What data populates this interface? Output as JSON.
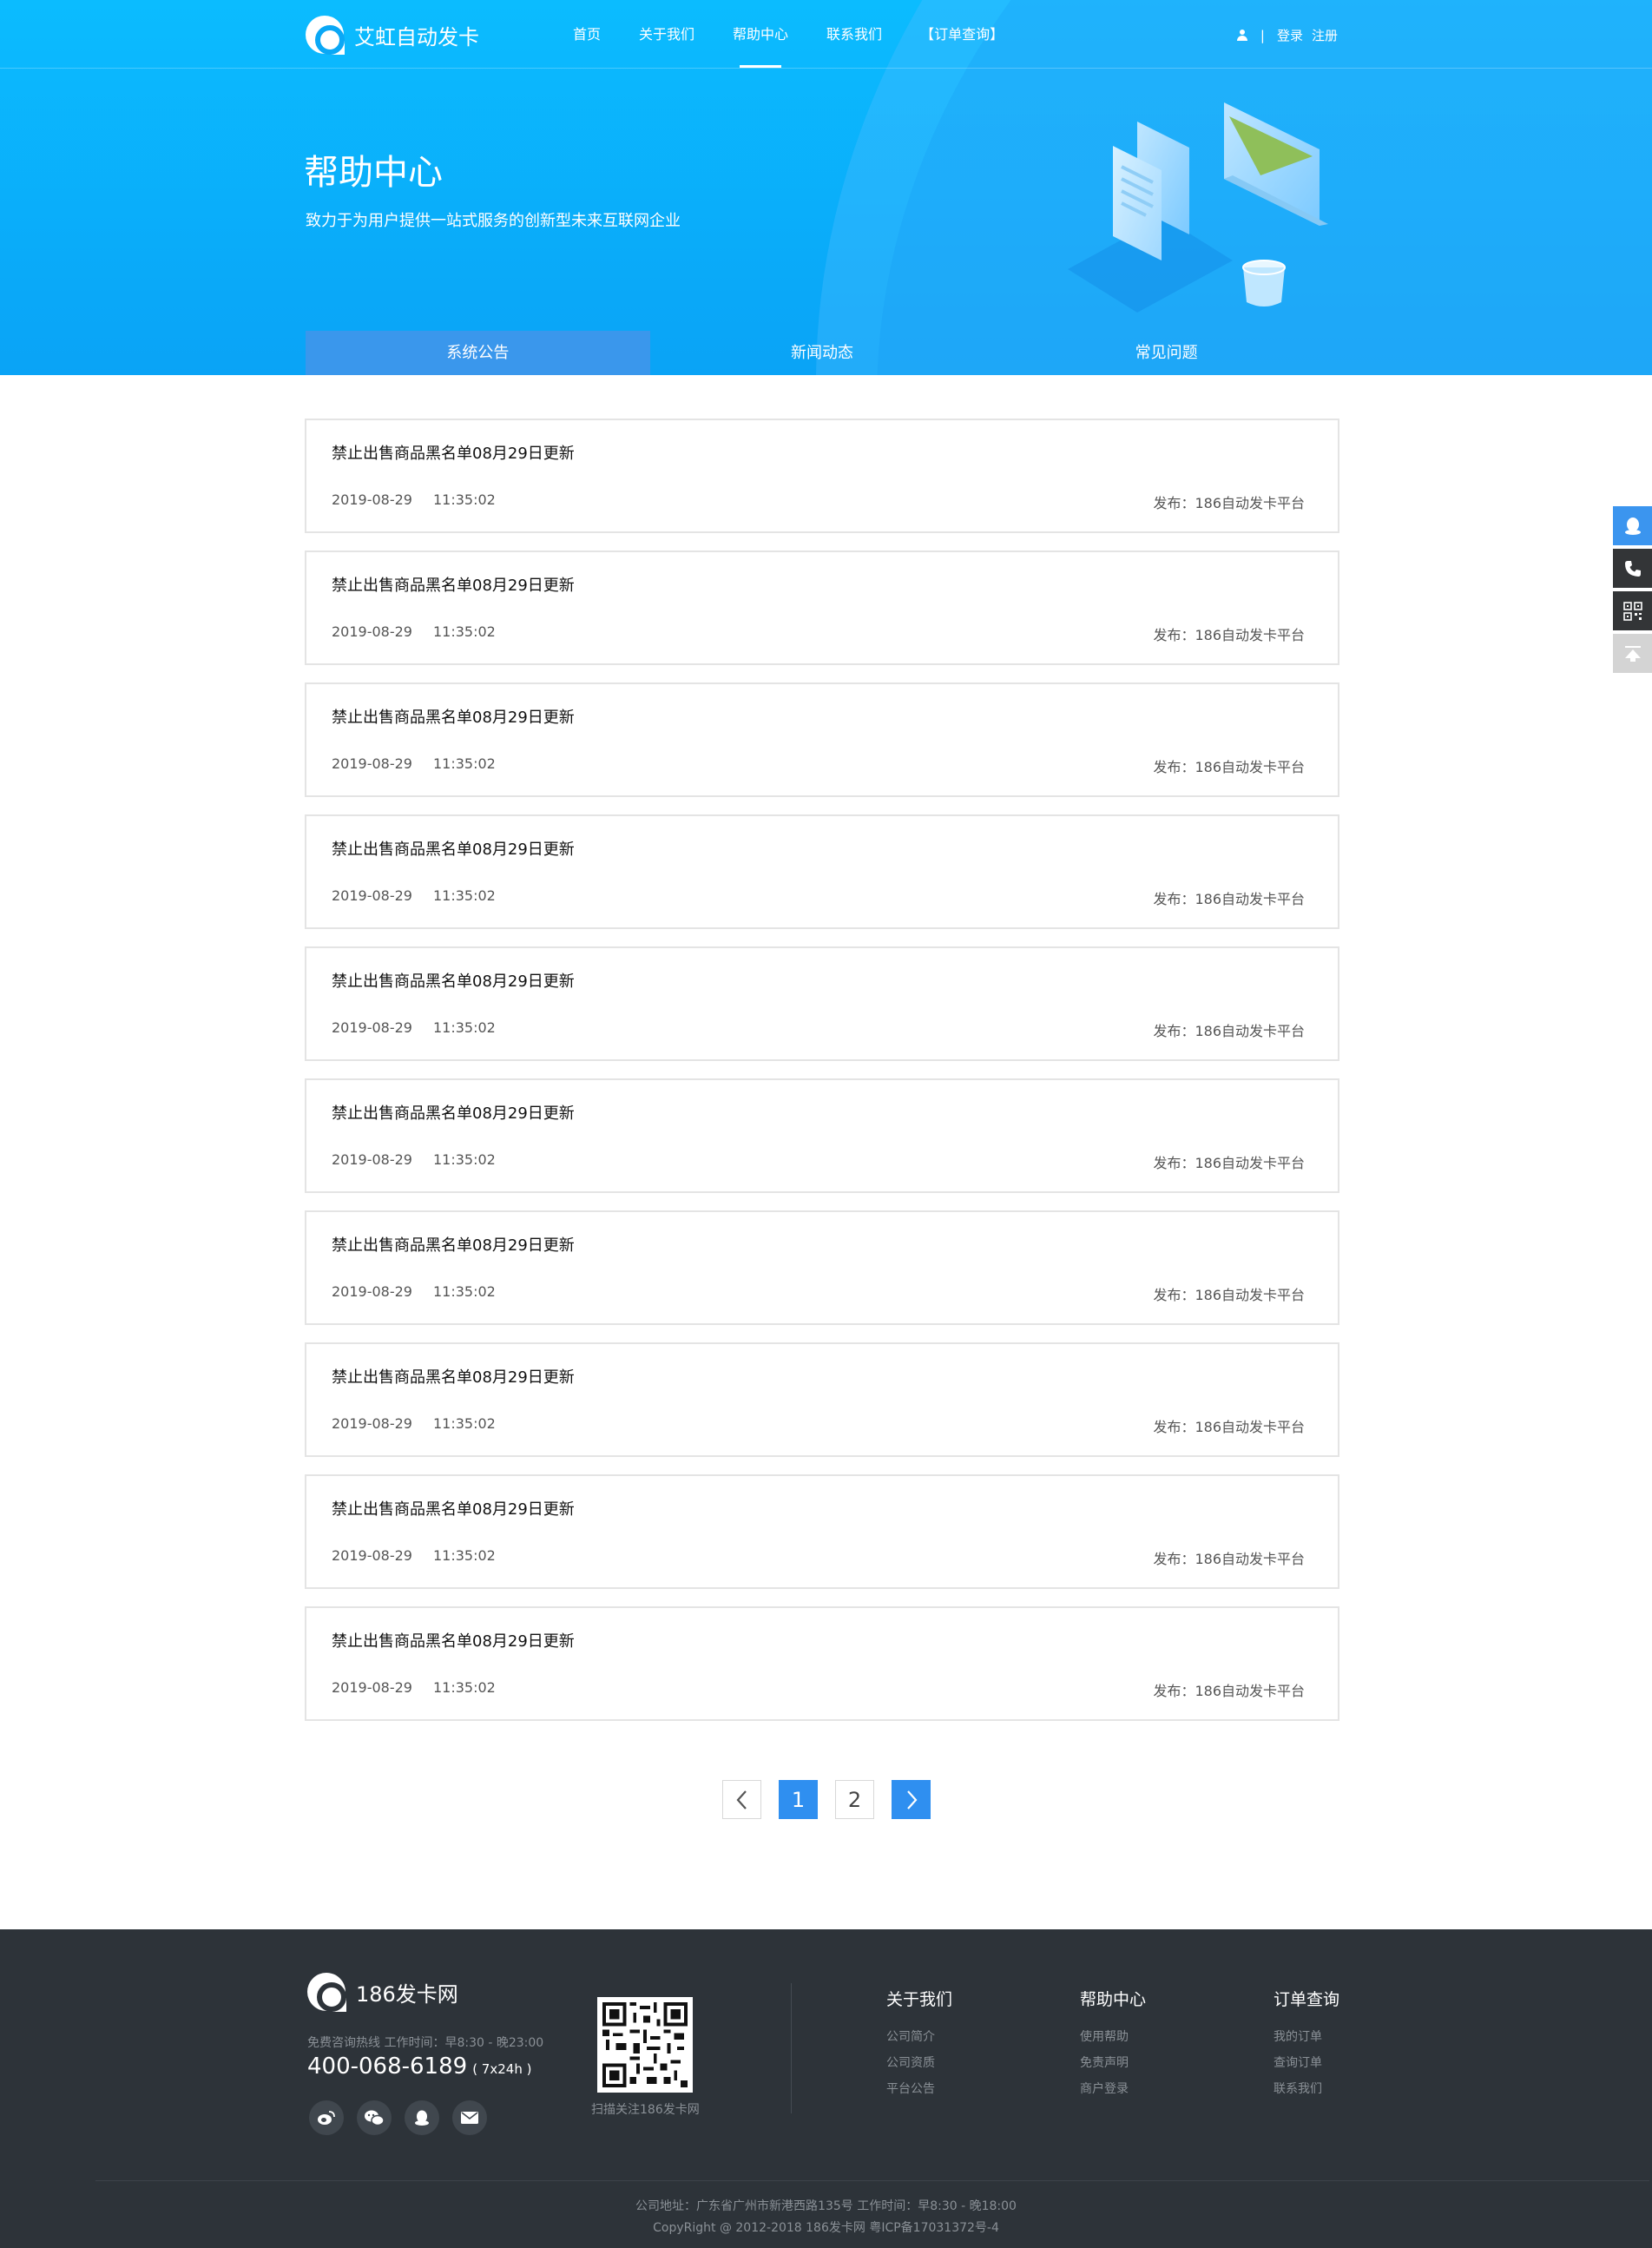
{
  "brand": {
    "name": "艾虹自动发卡",
    "accent": "#0aa8f6"
  },
  "nav": {
    "items": [
      {
        "label": "首页",
        "active": false
      },
      {
        "label": "关于我们",
        "active": false
      },
      {
        "label": "帮助中心",
        "active": true
      },
      {
        "label": "联系我们",
        "active": false
      },
      {
        "label": "【订单查询】",
        "active": false
      }
    ]
  },
  "auth": {
    "separator": "|",
    "login": "登录",
    "register": "注册"
  },
  "hero": {
    "title": "帮助中心",
    "subtitle": "致力于为用户提供一站式服务的创新型未来互联网企业"
  },
  "tabs": [
    {
      "label": "系统公告",
      "active": true
    },
    {
      "label": "新闻动态",
      "active": false
    },
    {
      "label": "常见问题",
      "active": false
    }
  ],
  "articles": [
    {
      "title": "禁止出售商品黑名单08月29日更新",
      "date": "2019-08-29",
      "time": "11:35:02",
      "publisher": "发布：186自动发卡平台"
    },
    {
      "title": "禁止出售商品黑名单08月29日更新",
      "date": "2019-08-29",
      "time": "11:35:02",
      "publisher": "发布：186自动发卡平台"
    },
    {
      "title": "禁止出售商品黑名单08月29日更新",
      "date": "2019-08-29",
      "time": "11:35:02",
      "publisher": "发布：186自动发卡平台"
    },
    {
      "title": "禁止出售商品黑名单08月29日更新",
      "date": "2019-08-29",
      "time": "11:35:02",
      "publisher": "发布：186自动发卡平台"
    },
    {
      "title": "禁止出售商品黑名单08月29日更新",
      "date": "2019-08-29",
      "time": "11:35:02",
      "publisher": "发布：186自动发卡平台"
    },
    {
      "title": "禁止出售商品黑名单08月29日更新",
      "date": "2019-08-29",
      "time": "11:35:02",
      "publisher": "发布：186自动发卡平台"
    },
    {
      "title": "禁止出售商品黑名单08月29日更新",
      "date": "2019-08-29",
      "time": "11:35:02",
      "publisher": "发布：186自动发卡平台"
    },
    {
      "title": "禁止出售商品黑名单08月29日更新",
      "date": "2019-08-29",
      "time": "11:35:02",
      "publisher": "发布：186自动发卡平台"
    },
    {
      "title": "禁止出售商品黑名单08月29日更新",
      "date": "2019-08-29",
      "time": "11:35:02",
      "publisher": "发布：186自动发卡平台"
    },
    {
      "title": "禁止出售商品黑名单08月29日更新",
      "date": "2019-08-29",
      "time": "11:35:02",
      "publisher": "发布：186自动发卡平台"
    }
  ],
  "pagination": {
    "pages": [
      "1",
      "2"
    ],
    "current": "1"
  },
  "side_tools": [
    "qq-icon",
    "phone-icon",
    "qrcode-icon",
    "back-to-top-icon"
  ],
  "footer": {
    "brand": "186发卡网",
    "hotline_label": "免费咨询热线  工作时间：早8:30 - 晚23:00",
    "phone": "400-068-6189",
    "phone_note": "( 7x24h )",
    "social": [
      "weibo-icon",
      "wechat-icon",
      "qq-icon",
      "mail-icon"
    ],
    "qr_caption": "扫描关注186发卡网",
    "columns": [
      {
        "title": "关于我们",
        "links": [
          "公司简介",
          "公司资质",
          "平台公告"
        ]
      },
      {
        "title": "帮助中心",
        "links": [
          "使用帮助",
          "免责声明",
          "商户登录"
        ]
      },
      {
        "title": "订单查询",
        "links": [
          "我的订单",
          "查询订单",
          "联系我们"
        ]
      }
    ],
    "address": "公司地址：广东省广州市新港西路135号    工作时间：早8:30 - 晚18:00",
    "copyright": "CopyRight @ 2012-2018 186发卡网  粤ICP备17031372号-4",
    "bg": "#2d3339"
  }
}
